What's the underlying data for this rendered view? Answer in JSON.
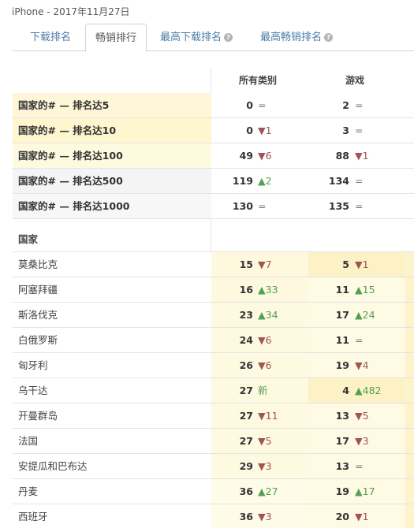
{
  "header": {
    "title": "iPhone - 2017年11月27日"
  },
  "tabs": [
    {
      "label": "下载排名",
      "active": false,
      "help": false
    },
    {
      "label": "畅销排行",
      "active": true,
      "help": false
    },
    {
      "label": "最高下载排名",
      "active": false,
      "help": true
    },
    {
      "label": "最高畅销排名",
      "active": false,
      "help": true
    }
  ],
  "help_icon": "?",
  "columns": [
    "所有类别",
    "游戏"
  ],
  "summary_rows": [
    {
      "label": "国家的# — 排名达5",
      "bg": "#fdf7d8",
      "c1": {
        "rank": "0",
        "change": "=",
        "dir": "same"
      },
      "c2": {
        "rank": "2",
        "change": "=",
        "dir": "same"
      }
    },
    {
      "label": "国家的# — 排名达10",
      "bg": "#fdf6cf",
      "c1": {
        "rank": "0",
        "change": "▼1",
        "dir": "down"
      },
      "c2": {
        "rank": "3",
        "change": "=",
        "dir": "same"
      }
    },
    {
      "label": "国家的# — 排名达100",
      "bg": "#fefadf",
      "c1": {
        "rank": "49",
        "change": "▼6",
        "dir": "down"
      },
      "c2": {
        "rank": "88",
        "change": "▼1",
        "dir": "down"
      }
    },
    {
      "label": "国家的# — 排名达500",
      "bg": "#f4f4f4",
      "c1": {
        "rank": "119",
        "change": "▲2",
        "dir": "up"
      },
      "c2": {
        "rank": "134",
        "change": "=",
        "dir": "same"
      }
    },
    {
      "label": "国家的# — 排名达1000",
      "bg": "#f7f7f7",
      "c1": {
        "rank": "130",
        "change": "=",
        "dir": "same"
      },
      "c2": {
        "rank": "135",
        "change": "=",
        "dir": "same"
      }
    }
  ],
  "country_section": {
    "label": "国家"
  },
  "country_rows": [
    {
      "label": "莫桑比克",
      "c1": {
        "rank": "15",
        "change": "▼7",
        "dir": "down",
        "bg": "#fef9de"
      },
      "c2": {
        "rank": "5",
        "change": "▼1",
        "dir": "down",
        "bg": "#fdf1c6"
      },
      "c3bg": "#fdf3cc"
    },
    {
      "label": "阿塞拜疆",
      "c1": {
        "rank": "16",
        "change": "▲33",
        "dir": "up",
        "bg": "#fef9de"
      },
      "c2": {
        "rank": "11",
        "change": "▲15",
        "dir": "up",
        "bg": "#fefae4"
      },
      "c3bg": "#fdf3cc"
    },
    {
      "label": "斯洛伐克",
      "c1": {
        "rank": "23",
        "change": "▲34",
        "dir": "up",
        "bg": "#fefae2"
      },
      "c2": {
        "rank": "17",
        "change": "▲24",
        "dir": "up",
        "bg": "#fefae4"
      },
      "c3bg": "#fdf3cc"
    },
    {
      "label": "白俄罗斯",
      "c1": {
        "rank": "24",
        "change": "▼6",
        "dir": "down",
        "bg": "#fefae2"
      },
      "c2": {
        "rank": "11",
        "change": "=",
        "dir": "same",
        "bg": "#fefae4"
      },
      "c3bg": "#fdf3cc"
    },
    {
      "label": "匈牙利",
      "c1": {
        "rank": "26",
        "change": "▼6",
        "dir": "down",
        "bg": "#fefae2"
      },
      "c2": {
        "rank": "19",
        "change": "▼4",
        "dir": "down",
        "bg": "#fefae4"
      },
      "c3bg": "#fdf3cc"
    },
    {
      "label": "乌干达",
      "c1": {
        "rank": "27",
        "change": "新",
        "dir": "new",
        "bg": "#fefae2"
      },
      "c2": {
        "rank": "4",
        "change": "▲482",
        "dir": "up",
        "bg": "#fdf1c6"
      },
      "c3bg": "#fdf3cc"
    },
    {
      "label": "开曼群岛",
      "c1": {
        "rank": "27",
        "change": "▼11",
        "dir": "down",
        "bg": "#fefae2"
      },
      "c2": {
        "rank": "13",
        "change": "▼5",
        "dir": "down",
        "bg": "#fefae4"
      },
      "c3bg": "#fdf3cc"
    },
    {
      "label": "法国",
      "c1": {
        "rank": "27",
        "change": "▼5",
        "dir": "down",
        "bg": "#fefae2"
      },
      "c2": {
        "rank": "17",
        "change": "▼3",
        "dir": "down",
        "bg": "#fefae4"
      },
      "c3bg": "#fdf3cc"
    },
    {
      "label": "安提瓜和巴布达",
      "c1": {
        "rank": "29",
        "change": "▼3",
        "dir": "down",
        "bg": "#fefae2"
      },
      "c2": {
        "rank": "13",
        "change": "=",
        "dir": "same",
        "bg": "#fefae4"
      },
      "c3bg": "#fdf3cc"
    },
    {
      "label": "丹麦",
      "c1": {
        "rank": "36",
        "change": "▲27",
        "dir": "up",
        "bg": "#fefbe8"
      },
      "c2": {
        "rank": "19",
        "change": "▲17",
        "dir": "up",
        "bg": "#fefae4"
      },
      "c3bg": "#fdf3cc"
    },
    {
      "label": "西班牙",
      "c1": {
        "rank": "36",
        "change": "▼3",
        "dir": "down",
        "bg": "#fefbe8"
      },
      "c2": {
        "rank": "20",
        "change": "▼1",
        "dir": "down",
        "bg": "#fefae4"
      },
      "c3bg": "#fdf3cc"
    }
  ]
}
